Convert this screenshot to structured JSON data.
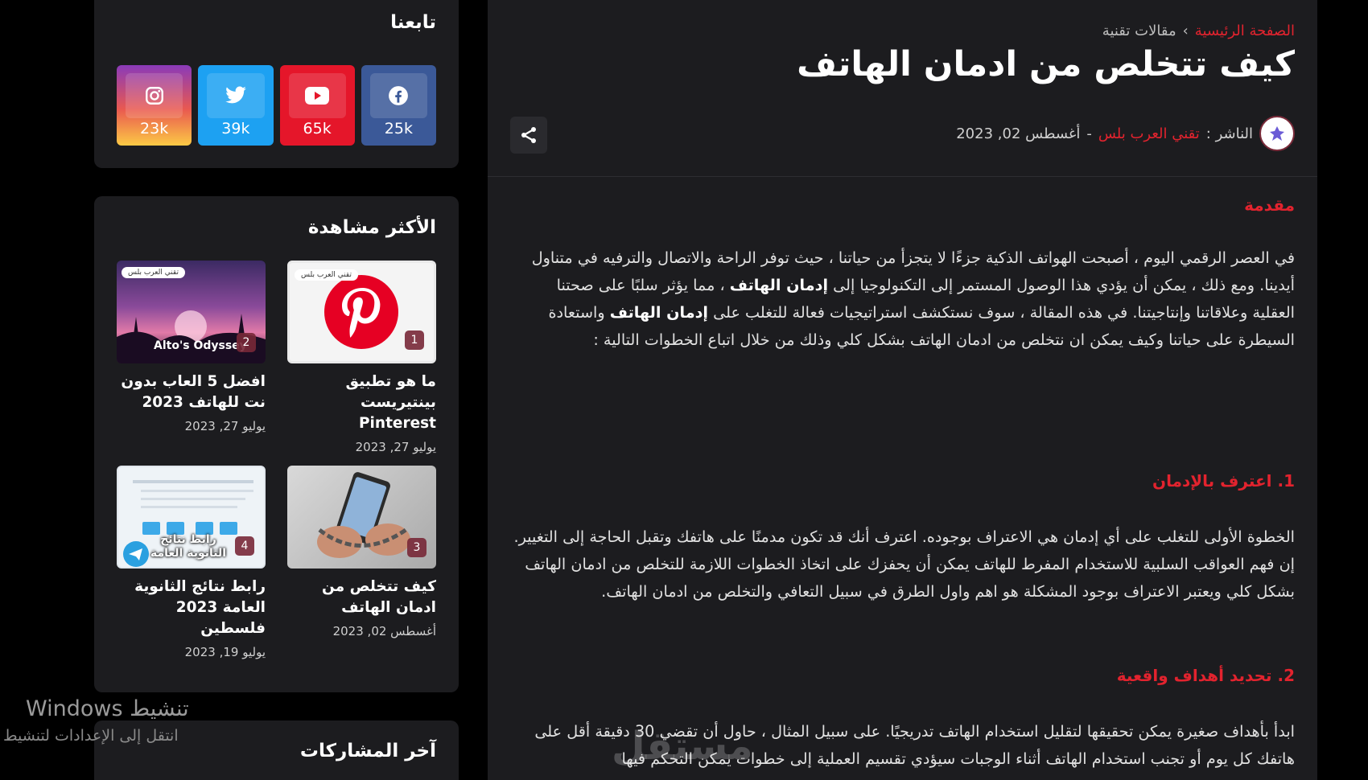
{
  "sidebar": {
    "follow": {
      "title": "تابعنا",
      "social": [
        {
          "name": "instagram",
          "icon": "instagram-icon",
          "count": "23k"
        },
        {
          "name": "twitter",
          "icon": "twitter-icon",
          "count": "39k"
        },
        {
          "name": "youtube",
          "icon": "youtube-icon",
          "count": "65k"
        },
        {
          "name": "facebook",
          "icon": "facebook-icon",
          "count": "25k"
        }
      ]
    },
    "popular": {
      "title": "الأكثر مشاهدة",
      "items": [
        {
          "rank": "1",
          "title": "ما هو تطبيق بينتيريست Pinterest",
          "date": "يوليو 27, 2023",
          "brand": "تقني العرب بلس"
        },
        {
          "rank": "2",
          "title": "افضل 5 العاب بدون نت للهاتف 2023",
          "date": "يوليو 27, 2023",
          "brand": "تقني العرب بلس",
          "thumb_text": "Alto's Odyssey"
        },
        {
          "rank": "3",
          "title": "كيف تتخلص من ادمان الهاتف",
          "date": "أغسطس 02, 2023"
        },
        {
          "rank": "4",
          "title": "رابط نتائج الثانوية العامة 2023 فلسطين",
          "date": "يوليو 19, 2023",
          "thumb_text": "رابط نتائج الثانوية العامة"
        }
      ]
    },
    "recent": {
      "title": "آخر المشاركات"
    }
  },
  "main": {
    "breadcrumb": {
      "home": "الصفحة الرئيسية",
      "separator": "›",
      "category": "مقالات تقنية"
    },
    "title": "كيف تتخلص من ادمان الهاتف",
    "meta": {
      "publisher_label": "الناشر :",
      "publisher": "تقني العرب بلس",
      "dash": "-",
      "date": "أغسطس 02, 2023"
    },
    "article": {
      "intro_heading": "مقدمة",
      "intro_p1": "في العصر الرقمي اليوم ، أصبحت الهواتف الذكية جزءًا لا يتجزأ من حياتنا ، حيث توفر الراحة والاتصال والترفيه في متناول أيدينا. ومع ذلك ، يمكن أن يؤدي هذا الوصول المستمر إلى التكنولوجيا إلى ",
      "intro_bold1": "إدمان الهاتف",
      "intro_p2": " ، مما يؤثر سلبًا على صحتنا العقلية وعلاقاتنا وإنتاجيتنا. في هذه المقالة ، سوف نستكشف استراتيجيات فعالة للتغلب على ",
      "intro_bold2": "إدمان الهاتف",
      "intro_p3": " واستعادة السيطرة على حياتنا وكيف يمكن ان نتخلص من ادمان الهاتف بشكل كلي  وذلك من خلال اتباع الخطوات التالية :",
      "h1": "1. اعترف بالإدمان",
      "p1": "الخطوة الأولى للتغلب على أي إدمان هي الاعتراف بوجوده. اعترف أنك قد تكون مدمنًا على هاتفك وتقبل الحاجة إلى التغيير. إن فهم العواقب السلبية للاستخدام المفرط للهاتف يمكن أن يحفزك على اتخاذ الخطوات اللازمة للتخلص من ادمان الهاتف بشكل كلي ويعتبر الاعتراف بوجود المشكلة هو اهم واول الطرق في سبيل التعافي والتخلص من ادمان الهاتف.",
      "h2": "2. تحديد أهداف واقعية",
      "p2": "ابدأ بأهداف صغيرة يمكن تحقيقها لتقليل استخدام الهاتف تدريجيًا. على سبيل المثال ، حاول أن تقضي 30 دقيقة أقل على هاتفك كل يوم أو تجنب استخدام الهاتف أثناء الوجبات سيؤدي تقسيم العملية إلى خطوات يمكن التحكم فيها"
    }
  },
  "overlay": {
    "windows_title": "تنشيط Windows",
    "windows_sub": "انتقل إلى الإعدادات لتنشيط",
    "watermark": "مستقل"
  }
}
